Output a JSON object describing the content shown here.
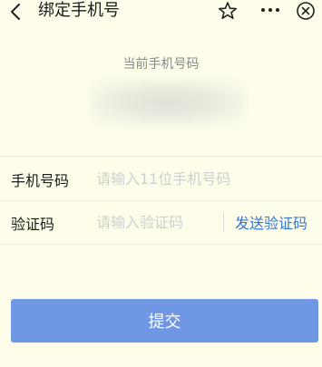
{
  "header": {
    "title": "绑定手机号",
    "icons": [
      "back-icon",
      "star-icon",
      "more-icon",
      "close-icon"
    ]
  },
  "current_phone": {
    "label": "当前手机号码"
  },
  "phone_row": {
    "label": "手机号码",
    "placeholder": "请输入11位手机号码",
    "value": ""
  },
  "code_row": {
    "label": "验证码",
    "placeholder": "请输入验证码",
    "value": "",
    "send_label": "发送验证码"
  },
  "submit": {
    "label": "提交"
  },
  "colors": {
    "background": "#fdfde9",
    "accent": "#3476d4",
    "button": "#6f97e4"
  }
}
